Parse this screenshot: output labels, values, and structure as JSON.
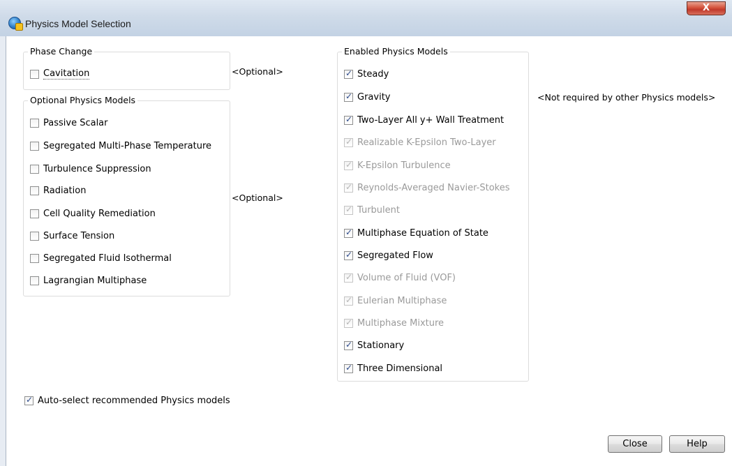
{
  "window": {
    "title": "Physics Model Selection",
    "close_glyph": "X"
  },
  "phase_change": {
    "title": "Phase Change",
    "items": [
      {
        "label": "Cavitation",
        "checked": false
      }
    ],
    "note": "<Optional>"
  },
  "optional_models": {
    "title": "Optional Physics Models",
    "items": [
      {
        "label": "Passive Scalar"
      },
      {
        "label": "Segregated Multi-Phase Temperature"
      },
      {
        "label": "Turbulence Suppression"
      },
      {
        "label": "Radiation"
      },
      {
        "label": "Cell Quality Remediation"
      },
      {
        "label": "Surface Tension"
      },
      {
        "label": "Segregated Fluid Isothermal"
      },
      {
        "label": "Lagrangian Multiphase"
      }
    ],
    "note": "<Optional>"
  },
  "enabled_models": {
    "title": "Enabled Physics Models",
    "items": [
      {
        "label": "Steady",
        "state": "checked"
      },
      {
        "label": "Gravity",
        "state": "checked"
      },
      {
        "label": "Two-Layer All y+ Wall Treatment",
        "state": "checked"
      },
      {
        "label": "Realizable K-Epsilon Two-Layer",
        "state": "disabled"
      },
      {
        "label": "K-Epsilon Turbulence",
        "state": "disabled"
      },
      {
        "label": "Reynolds-Averaged Navier-Stokes",
        "state": "disabled"
      },
      {
        "label": "Turbulent",
        "state": "disabled"
      },
      {
        "label": "Multiphase Equation of State",
        "state": "checked"
      },
      {
        "label": "Segregated Flow",
        "state": "checked"
      },
      {
        "label": "Volume of Fluid (VOF)",
        "state": "disabled"
      },
      {
        "label": "Eulerian Multiphase",
        "state": "disabled"
      },
      {
        "label": "Multiphase Mixture",
        "state": "disabled"
      },
      {
        "label": "Stationary",
        "state": "checked"
      },
      {
        "label": "Three Dimensional",
        "state": "checked"
      }
    ],
    "gravity_note": "<Not required by other Physics models>"
  },
  "auto_select": {
    "label": "Auto-select recommended Physics models",
    "checked": true
  },
  "buttons": {
    "close": "Close",
    "help": "Help"
  }
}
